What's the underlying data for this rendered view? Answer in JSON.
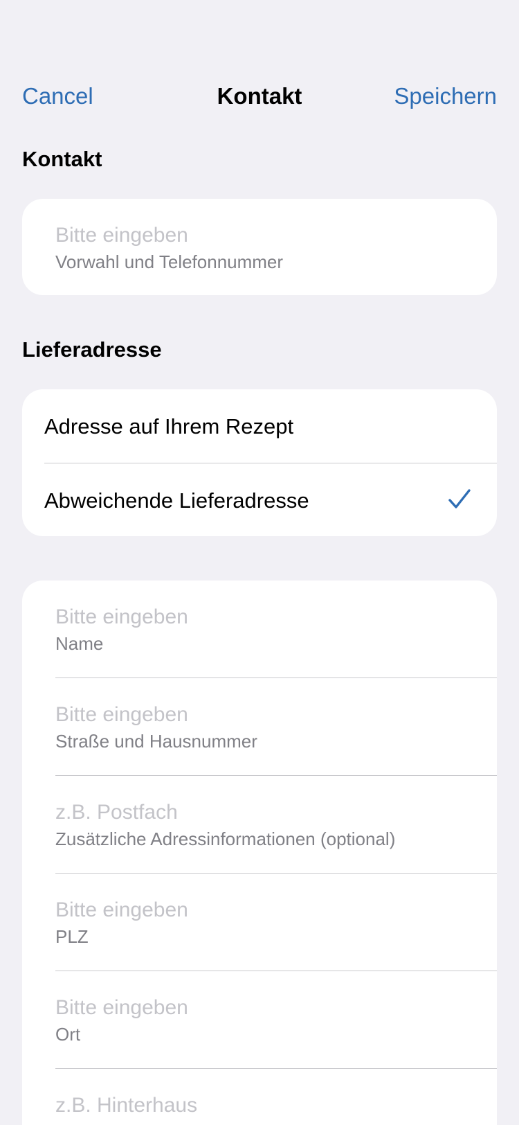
{
  "nav": {
    "cancel_label": "Cancel",
    "title": "Kontakt",
    "save_label": "Speichern"
  },
  "contact_section": {
    "header": "Kontakt",
    "phone": {
      "placeholder": "Bitte eingeben",
      "label": "Vorwahl und Telefonnummer"
    }
  },
  "delivery_section": {
    "header": "Lieferadresse",
    "options": [
      {
        "label": "Adresse auf Ihrem Rezept",
        "selected": false
      },
      {
        "label": "Abweichende Lieferadresse",
        "selected": true
      }
    ],
    "accent_color": "#2e6db4"
  },
  "address_fields": [
    {
      "placeholder": "Bitte eingeben",
      "label": "Name"
    },
    {
      "placeholder": "Bitte eingeben",
      "label": "Straße und Hausnummer"
    },
    {
      "placeholder": "z.B. Postfach",
      "label": "Zusätzliche Adressinformationen (optional)"
    },
    {
      "placeholder": "Bitte eingeben",
      "label": "PLZ"
    },
    {
      "placeholder": "Bitte eingeben",
      "label": "Ort"
    },
    {
      "placeholder": "z.B. Hinterhaus",
      "label": ""
    }
  ]
}
